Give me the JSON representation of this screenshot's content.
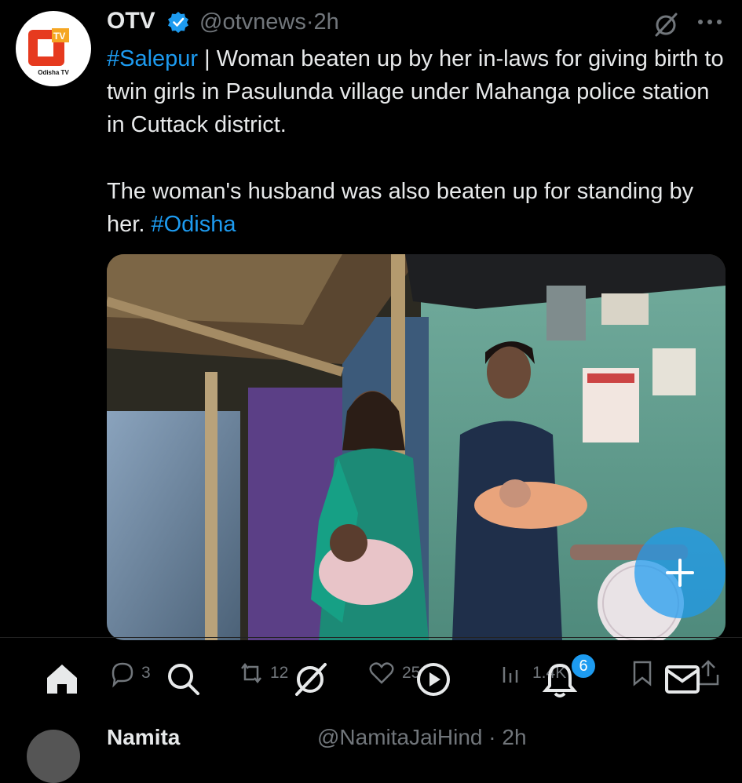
{
  "tweet": {
    "author_name": "OTV",
    "handle": "@otvnews",
    "separator": "·",
    "time": "2h",
    "avatar_caption": "Odisha TV",
    "avatar_logo_text": "TV",
    "paragraph1": {
      "hashtag": "#Salepur",
      "text": " | Woman beaten up by her in-laws for giving birth to twin girls in Pasulunda village under Mahanga police station in Cuttack district."
    },
    "paragraph2": {
      "text": "The woman's husband was also beaten up for standing by her. ",
      "hashtag": "#Odisha"
    }
  },
  "actions": {
    "reply_count": "3",
    "retweet_count": "12",
    "like_count": "25",
    "views_count": "1.4K"
  },
  "nav": {
    "notifications_badge": "6"
  },
  "next_tweet": {
    "name": "Namita",
    "handle": "@NamitaJaiHind · 2h"
  },
  "icons": [
    "verified-icon",
    "grok-icon",
    "more-icon",
    "reply-icon",
    "retweet-icon",
    "like-icon",
    "views-icon",
    "bookmark-icon",
    "share-icon",
    "home-icon",
    "search-icon",
    "grok-nav-icon",
    "video-icon",
    "notifications-icon",
    "messages-icon",
    "compose-icon"
  ],
  "colors": {
    "background": "#000000",
    "text": "#e7e9ea",
    "muted": "#71767b",
    "accent": "#1d9bf0",
    "brand_red": "#e63a1f"
  }
}
